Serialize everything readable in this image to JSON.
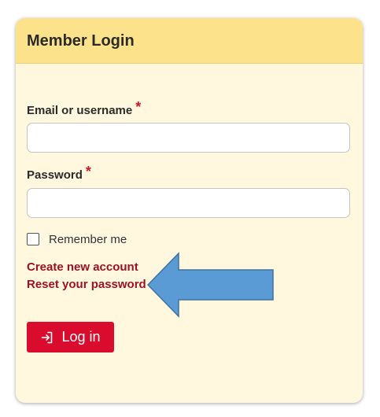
{
  "login_box": {
    "title": "Member Login",
    "email_label": "Email or username",
    "email_required": "*",
    "email_value": "",
    "password_label": "Password",
    "password_required": "*",
    "password_value": "",
    "remember_label": "Remember me",
    "remember_checked": false,
    "create_account_link": "Create new account",
    "reset_password_link": "Reset your password",
    "login_button": "Log in",
    "login_icon": "log-in-icon"
  },
  "annotation": {
    "arrow_icon": "left-arrow-icon",
    "arrow_color": "#5b9bd5"
  },
  "colors": {
    "header_bg": "#fde28c",
    "card_bg": "#fff8df",
    "accent_red": "#d90c2d",
    "link_color": "#9c1224"
  }
}
